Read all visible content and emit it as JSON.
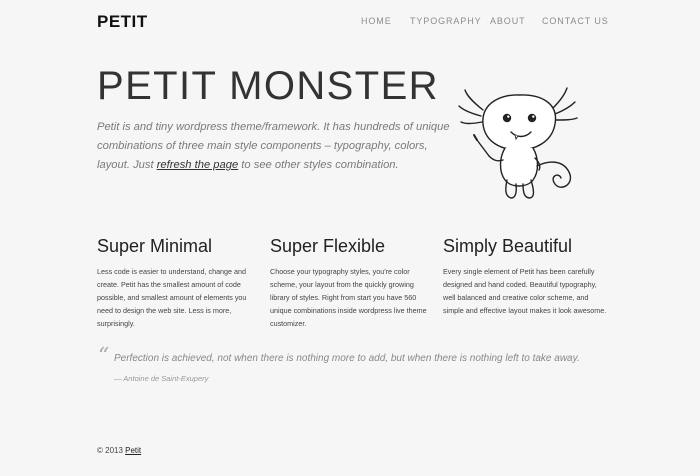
{
  "header": {
    "logo": "PETIT",
    "nav": [
      "HOME",
      "TYPOGRAPHY",
      "ABOUT",
      "CONTACT US"
    ]
  },
  "hero": {
    "title": "PETIT MONSTER",
    "desc_part1": "Petit is and tiny wordpress theme/framework. It has hundreds of unique combinations of three main style components – typography, colors, layout. Just ",
    "desc_link": "refresh the page",
    "desc_part2": " to see other styles combination."
  },
  "features": [
    {
      "title": "Super Minimal",
      "text": "Less code is easier to understand, change and create. Petit has the smallest amount of code possible, and smallest amount of elements you need to design the web site. Less is more, surprisingly."
    },
    {
      "title": "Super Flexible",
      "text": "Choose your typography styles, you're color scheme, your layout from the quickly growing library of styles. Right from start you have 560 unique combinations inside wordpress live theme customizer."
    },
    {
      "title": "Simply Beautiful",
      "text": "Every single element of Petit has been carefully designed and hand coded. Beautiful typography, well balanced and creative color scheme, and simple and effective layout makes it look awesome."
    }
  ],
  "quote": {
    "mark": "“",
    "text": "Perfection is achieved, not when there is nothing more to add, but when there is nothing left to take away.",
    "author": "— Antoine de Saint-Exupery"
  },
  "footer": {
    "copyright": "© 2013 ",
    "link": "Petit"
  }
}
